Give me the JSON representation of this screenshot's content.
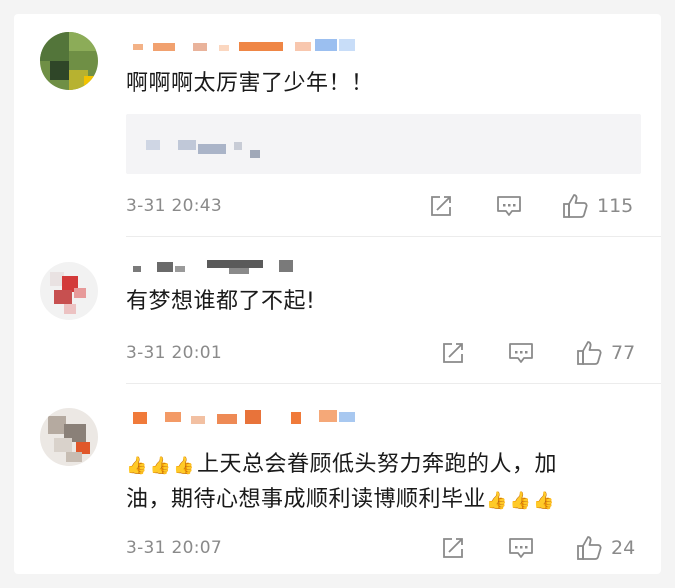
{
  "comments": [
    {
      "text": "啊啊啊太厉害了少年！！",
      "time": "3-31 20:43",
      "likes": "115"
    },
    {
      "text": "有梦想谁都了不起!",
      "time": "3-31 20:01",
      "likes": "77"
    },
    {
      "text_line1": "上天总会眷顾低头努力奔跑的人，加",
      "text_line2": "油，期待心想事成顺利读博顺利毕业",
      "emoji": "👍",
      "time": "3-31 20:07",
      "likes": "24"
    }
  ],
  "icons": {
    "share": "share-icon",
    "reply": "reply-icon",
    "like": "thumbs-up-icon",
    "emoji": "thumbs-up-emoji-icon"
  },
  "colors": {
    "text": "#1a1a1a",
    "meta": "#8a8a8a",
    "quote_bg": "#f4f4f6",
    "divider": "#ececec"
  }
}
